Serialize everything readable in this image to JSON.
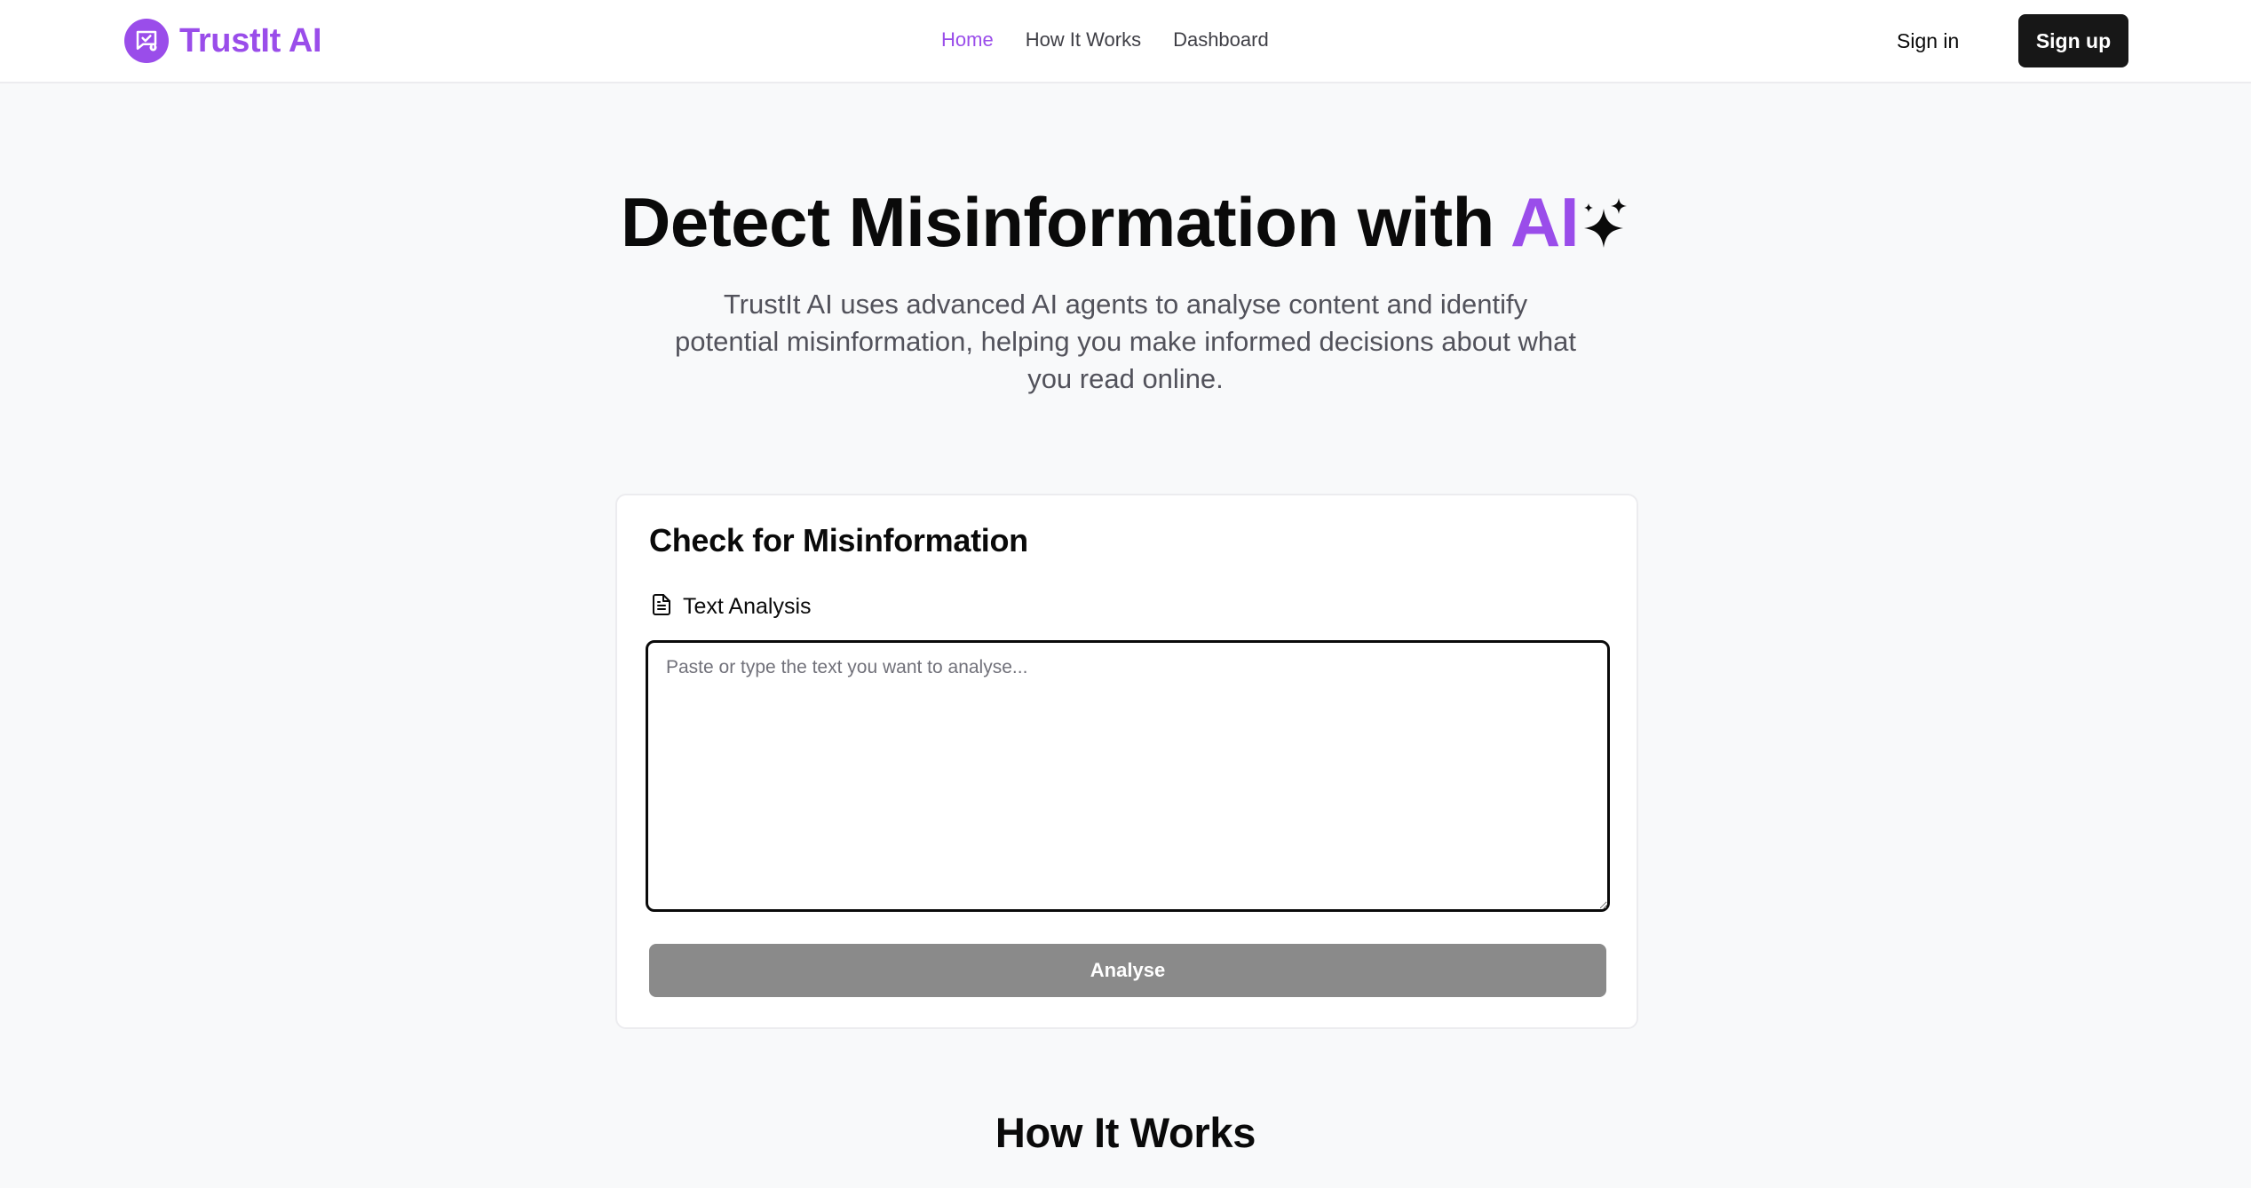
{
  "header": {
    "logo_text": "TrustIt AI",
    "nav": {
      "home": "Home",
      "how_it_works": "How It Works",
      "dashboard": "Dashboard"
    },
    "active_nav": "Home",
    "sign_in": "Sign in",
    "sign_up": "Sign up"
  },
  "hero": {
    "title_main": "Detect Misinformation with ",
    "title_accent": "AI",
    "subtitle": "TrustIt AI uses advanced AI agents to analyse content and identify potential misinformation, helping you make informed decisions about what you read online."
  },
  "checker": {
    "title": "Check for Misinformation",
    "mode_label": "Text Analysis",
    "input_value": "",
    "input_placeholder": "Paste or type the text you want to analyse...",
    "analyse_label": "Analyse"
  },
  "how_it_works": {
    "title": "How It Works"
  },
  "colors": {
    "brand": "#9a4dea",
    "dark_button": "#171717",
    "disabled_button": "#8a8a8a",
    "page_background": "#f8f9fa"
  },
  "icons": {
    "logo": "shield-check-icon",
    "sparkles": "sparkles-icon",
    "text_mode": "file-text-icon"
  }
}
